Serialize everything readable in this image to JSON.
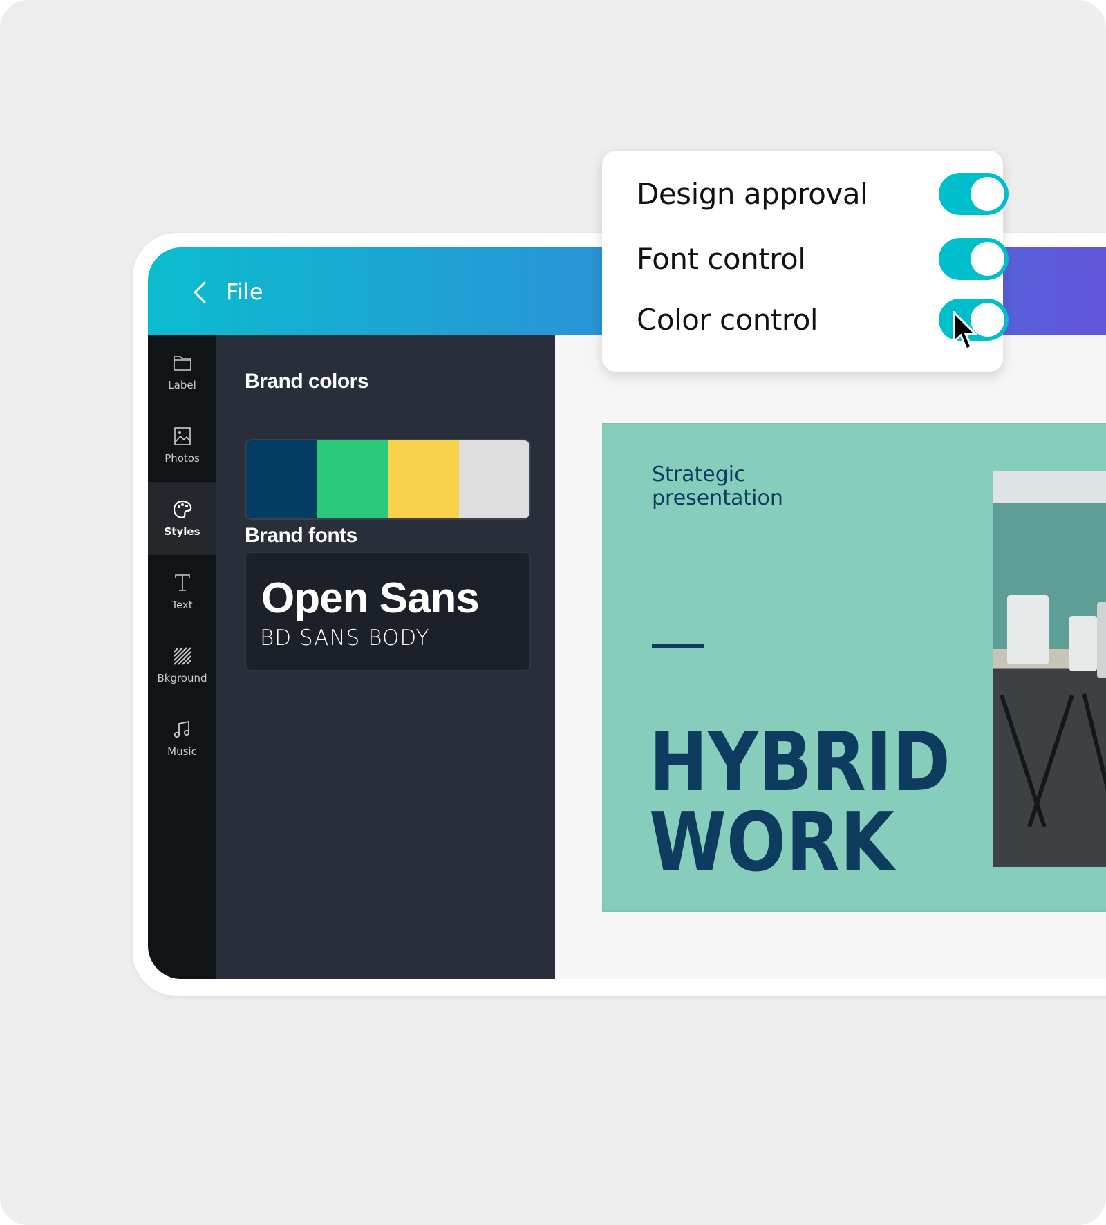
{
  "header": {
    "back_icon": "chevron-left-icon",
    "title": "File"
  },
  "sidebar": {
    "items": [
      {
        "label": "Label",
        "icon": "folder-icon",
        "active": false
      },
      {
        "label": "Photos",
        "icon": "image-icon",
        "active": false
      },
      {
        "label": "Styles",
        "icon": "palette-icon",
        "active": true
      },
      {
        "label": "Text",
        "icon": "text-icon",
        "active": false
      },
      {
        "label": "Bkground",
        "icon": "background-pattern-icon",
        "active": false
      },
      {
        "label": "Music",
        "icon": "music-note-icon",
        "active": false
      }
    ]
  },
  "panel": {
    "brand_colors_heading": "Brand colors",
    "brand_colors": [
      "#033d63",
      "#2ac977",
      "#f7d24a",
      "#dedede"
    ],
    "brand_fonts_heading": "Brand fonts",
    "font_heading": "Open Sans",
    "font_body": "BD SANS BODY"
  },
  "slide": {
    "subtitle_line1": "Strategic",
    "subtitle_line2": "presentation",
    "title_line1": "HYBRID",
    "title_line2": "WORK",
    "text_color": "#0e3c5e",
    "background": "#86cdbc"
  },
  "popup": {
    "toggles": [
      {
        "label": "Design approval",
        "on": true
      },
      {
        "label": "Font control",
        "on": true
      },
      {
        "label": "Color control",
        "on": true
      }
    ],
    "accent": "#00bfcc"
  }
}
